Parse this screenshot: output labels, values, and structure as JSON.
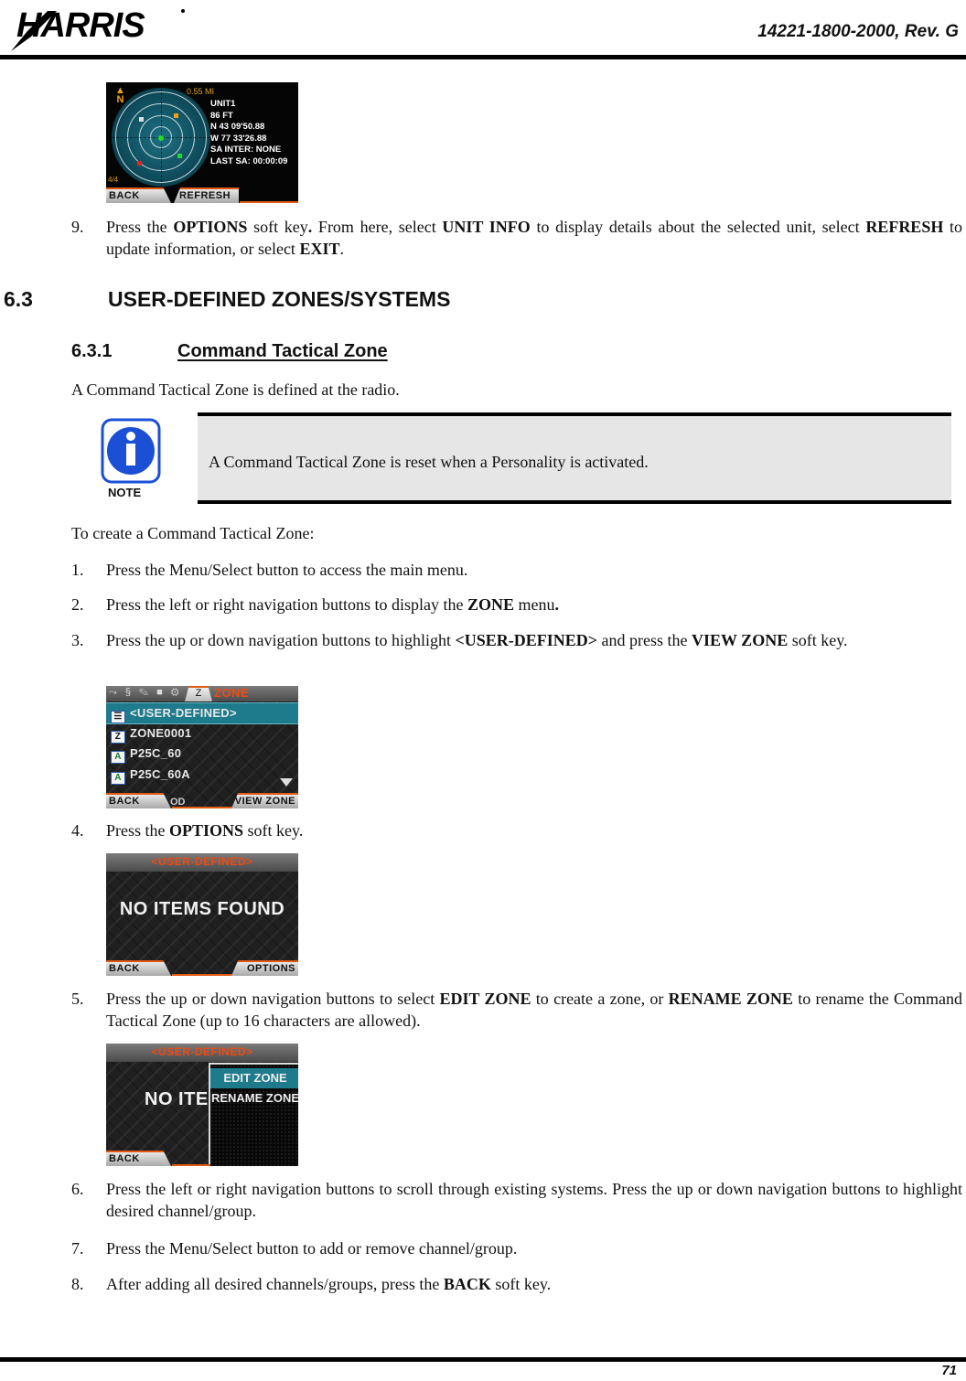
{
  "header": {
    "brand": "HARRIS",
    "doc_number": "14221-1800-2000, Rev. G"
  },
  "footer": {
    "page_number": "71"
  },
  "screen_sa": {
    "north_label": "N",
    "distance": "0.55 MI",
    "info_lines": [
      "UNIT1",
      "86 FT",
      "N 43 09'50.88",
      "W 77 33'26.88",
      "SA INTER: NONE",
      "LAST SA: 00:00:09"
    ],
    "page": "4/4",
    "softkeys": {
      "left": "BACK",
      "right": "REFRESH"
    },
    "markers": [
      {
        "name": "self",
        "color": "#22dd22"
      },
      {
        "name": "unit-white",
        "color": "#dddddd"
      },
      {
        "name": "unit-orange",
        "color": "#f0a020"
      },
      {
        "name": "unit-green",
        "color": "#22dd22"
      },
      {
        "name": "unit-red",
        "color": "#ee2020"
      }
    ]
  },
  "step9": {
    "num": "9.",
    "parts": [
      "Press the ",
      "OPTIONS",
      " soft key",
      ".",
      " From here, select ",
      "UNIT INFO",
      " to display details about the selected unit, select ",
      "REFRESH",
      " to update information, or select ",
      "EXIT",
      "."
    ]
  },
  "section": {
    "number": "6.3",
    "title": "USER-DEFINED ZONES/SYSTEMS"
  },
  "subsection": {
    "number": "6.3.1",
    "title": "Command Tactical Zone"
  },
  "intro": "A Command Tactical Zone is defined at the radio.",
  "note": {
    "label": "NOTE",
    "text": "A Command Tactical Zone is reset when a Personality is activated."
  },
  "lead_in": "To create a Command Tactical Zone:",
  "steps": [
    {
      "num": "1.",
      "parts": [
        "Press the Menu/Select button to access the main menu."
      ]
    },
    {
      "num": "2.",
      "parts": [
        "Press the left or right navigation buttons to display the ",
        "ZONE",
        " menu",
        "."
      ]
    },
    {
      "num": "3.",
      "parts": [
        "Press the up or down navigation buttons to highlight ",
        "<USER-DEFINED>",
        " and press the ",
        "VIEW ZONE",
        " soft key."
      ]
    },
    {
      "num": "4.",
      "parts": [
        "Press the ",
        "OPTIONS",
        " soft key."
      ]
    },
    {
      "num": "5.",
      "parts": [
        "Press the up or down navigation buttons to select ",
        "EDIT ZONE",
        " to create a zone, or ",
        "RENAME ZONE",
        " to rename the Command Tactical Zone (up to 16 characters are allowed)."
      ]
    },
    {
      "num": "6.",
      "parts": [
        "Press the left or right navigation buttons to scroll through existing systems. Press the up or down navigation buttons to highlight desired channel/group."
      ]
    },
    {
      "num": "7.",
      "parts": [
        "Press the Menu/Select button to add or remove channel/group."
      ]
    },
    {
      "num": "8.",
      "parts": [
        "After adding all desired channels/groups, press the ",
        "BACK",
        " soft key."
      ]
    }
  ],
  "screen_zone": {
    "tab_icons": "⤳ § ✎ ■ ⚙",
    "tab_active": "Z",
    "title": "ZONE",
    "rows": [
      {
        "icon": "☰",
        "label": "<USER-DEFINED>",
        "selected": true
      },
      {
        "icon": "Z",
        "label": "ZONE0001",
        "selected": false
      },
      {
        "icon": "A",
        "label": "P25C_60",
        "selected": false
      },
      {
        "icon": "A",
        "label": "P25C_60A",
        "selected": false
      }
    ],
    "hidden_label": "OD",
    "softkeys": {
      "left": "BACK",
      "right": "VIEW ZONE"
    }
  },
  "screen_empty": {
    "title": "<USER-DEFINED>",
    "message": "NO ITEMS FOUND",
    "softkeys": {
      "left": "BACK",
      "right": "OPTIONS"
    }
  },
  "screen_options": {
    "title": "<USER-DEFINED>",
    "message": "NO ITEMS",
    "options": [
      {
        "label": "EDIT ZONE",
        "selected": true
      },
      {
        "label": "RENAME ZONE",
        "selected": false
      }
    ],
    "softkeys": {
      "left": "BACK"
    }
  },
  "colors": {
    "accent_orange": "#e25a12",
    "highlight_teal": "#1e7b8c",
    "note_bg": "#e6e6e6",
    "note_blue": "#1a4fd6"
  }
}
